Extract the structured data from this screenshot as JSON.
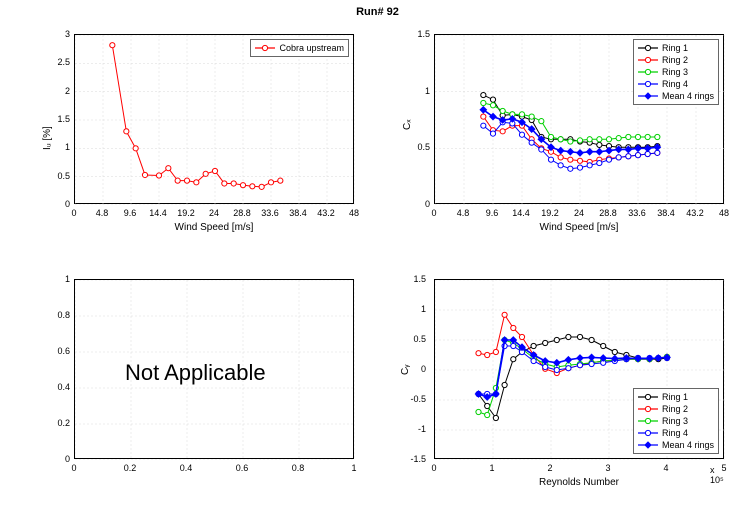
{
  "title": "Run# 92",
  "panels": {
    "tl": {
      "xlabel": "Wind Speed [m/s]",
      "ylabel": "Iᵤ [%]"
    },
    "tr": {
      "xlabel": "Wind Speed [m/s]",
      "ylabel": "Cₓ"
    },
    "bl": {
      "xlabel": "",
      "ylabel": "",
      "text": "Not Applicable"
    },
    "br": {
      "xlabel": "Reynolds Number",
      "ylabel": "Cᵧ",
      "exp": "x 10⁵"
    }
  },
  "legends": {
    "tl": [
      {
        "label": "Cobra upstream",
        "color": "#ff0000",
        "marker": "o"
      }
    ],
    "tr": [
      {
        "label": "Ring 1",
        "color": "#000000",
        "marker": "o"
      },
      {
        "label": "Ring 2",
        "color": "#ff0000",
        "marker": "o"
      },
      {
        "label": "Ring 3",
        "color": "#00d000",
        "marker": "o"
      },
      {
        "label": "Ring 4",
        "color": "#0000ff",
        "marker": "o"
      },
      {
        "label": "Mean 4 rings",
        "color": "#0000ff",
        "marker": "d",
        "fill": true
      }
    ],
    "br": [
      {
        "label": "Ring 1",
        "color": "#000000",
        "marker": "o"
      },
      {
        "label": "Ring 2",
        "color": "#ff0000",
        "marker": "o"
      },
      {
        "label": "Ring 3",
        "color": "#00d000",
        "marker": "o"
      },
      {
        "label": "Ring 4",
        "color": "#0000ff",
        "marker": "o"
      },
      {
        "label": "Mean 4 rings",
        "color": "#0000ff",
        "marker": "d",
        "fill": true
      }
    ]
  },
  "axes": {
    "tl": {
      "xlim": [
        0,
        48
      ],
      "ylim": [
        0,
        3
      ],
      "xticks": [
        0,
        4.8,
        9.6,
        14.4,
        19.2,
        24,
        28.8,
        33.6,
        38.4,
        43.2,
        48
      ],
      "yticks": [
        0,
        0.5,
        1,
        1.5,
        2,
        2.5,
        3
      ]
    },
    "tr": {
      "xlim": [
        0,
        48
      ],
      "ylim": [
        0,
        1.5
      ],
      "xticks": [
        0,
        4.8,
        9.6,
        14.4,
        19.2,
        24,
        28.8,
        33.6,
        38.4,
        43.2,
        48
      ],
      "yticks": [
        0,
        0.5,
        1,
        1.5
      ]
    },
    "bl": {
      "xlim": [
        0,
        1
      ],
      "ylim": [
        0,
        1
      ],
      "xticks": [
        0,
        0.2,
        0.4,
        0.6,
        0.8,
        1
      ],
      "yticks": [
        0,
        0.2,
        0.4,
        0.6,
        0.8,
        1
      ]
    },
    "br": {
      "xlim": [
        0,
        5
      ],
      "ylim": [
        -1.5,
        1.5
      ],
      "xticks": [
        0,
        1,
        2,
        3,
        4,
        5
      ],
      "yticks": [
        -1.5,
        -1,
        -0.5,
        0,
        0.5,
        1,
        1.5
      ]
    }
  },
  "chart_data": [
    {
      "id": "tl",
      "type": "line",
      "title": "",
      "xlabel": "Wind Speed [m/s]",
      "ylabel": "Iu [%]",
      "xlim": [
        0,
        48
      ],
      "ylim": [
        0,
        3
      ],
      "series": [
        {
          "name": "Cobra upstream",
          "color": "#ff0000",
          "marker": "o",
          "x": [
            6.4,
            8.8,
            10.4,
            12.0,
            14.4,
            16.0,
            17.6,
            19.2,
            20.8,
            22.4,
            24.0,
            25.6,
            27.2,
            28.8,
            30.4,
            32.0,
            33.6,
            35.2
          ],
          "y": [
            2.82,
            1.3,
            1.0,
            0.53,
            0.52,
            0.65,
            0.43,
            0.43,
            0.4,
            0.55,
            0.6,
            0.38,
            0.38,
            0.35,
            0.33,
            0.32,
            0.4,
            0.43
          ]
        }
      ]
    },
    {
      "id": "tr",
      "type": "line",
      "title": "",
      "xlabel": "Wind Speed [m/s]",
      "ylabel": "Cx",
      "xlim": [
        0,
        48
      ],
      "ylim": [
        0,
        1.5
      ],
      "x": [
        8.0,
        9.6,
        11.2,
        12.8,
        14.4,
        16.0,
        17.6,
        19.2,
        20.8,
        22.4,
        24.0,
        25.6,
        27.2,
        28.8,
        30.4,
        32.0,
        33.6,
        35.2,
        36.8
      ],
      "series": [
        {
          "name": "Ring 1",
          "color": "#000000",
          "marker": "o",
          "y": [
            0.97,
            0.93,
            0.79,
            0.8,
            0.78,
            0.75,
            0.6,
            0.58,
            0.58,
            0.58,
            0.56,
            0.55,
            0.53,
            0.52,
            0.51,
            0.51,
            0.51,
            0.51,
            0.52
          ]
        },
        {
          "name": "Ring 2",
          "color": "#ff0000",
          "marker": "o",
          "y": [
            0.78,
            0.66,
            0.65,
            0.7,
            0.7,
            0.58,
            0.5,
            0.47,
            0.42,
            0.4,
            0.39,
            0.38,
            0.4,
            0.41,
            0.42,
            0.43,
            0.44,
            0.45,
            0.46
          ]
        },
        {
          "name": "Ring 3",
          "color": "#00d000",
          "marker": "o",
          "y": [
            0.9,
            0.88,
            0.83,
            0.8,
            0.8,
            0.78,
            0.74,
            0.6,
            0.58,
            0.56,
            0.57,
            0.58,
            0.58,
            0.58,
            0.59,
            0.6,
            0.6,
            0.6,
            0.6
          ]
        },
        {
          "name": "Ring 4",
          "color": "#0000ff",
          "marker": "o",
          "y": [
            0.7,
            0.63,
            0.73,
            0.72,
            0.62,
            0.55,
            0.49,
            0.4,
            0.35,
            0.32,
            0.33,
            0.35,
            0.37,
            0.4,
            0.42,
            0.43,
            0.44,
            0.45,
            0.46
          ]
        },
        {
          "name": "Mean 4 rings",
          "color": "#0000ff",
          "marker": "d",
          "fill": true,
          "y": [
            0.84,
            0.78,
            0.75,
            0.76,
            0.73,
            0.67,
            0.58,
            0.51,
            0.48,
            0.47,
            0.46,
            0.47,
            0.47,
            0.48,
            0.49,
            0.49,
            0.5,
            0.5,
            0.51
          ]
        }
      ]
    },
    {
      "id": "bl",
      "type": "line",
      "text": "Not Applicable",
      "xlim": [
        0,
        1
      ],
      "ylim": [
        0,
        1
      ],
      "series": []
    },
    {
      "id": "br",
      "type": "line",
      "xlabel": "Reynolds Number",
      "ylabel": "Cy",
      "xlim": [
        0,
        5
      ],
      "ylim": [
        -1.5,
        1.5
      ],
      "x_scale_note": "x10^5",
      "x": [
        0.75,
        0.9,
        1.05,
        1.2,
        1.35,
        1.5,
        1.7,
        1.9,
        2.1,
        2.3,
        2.5,
        2.7,
        2.9,
        3.1,
        3.3,
        3.5,
        3.7,
        3.85,
        4.0
      ],
      "series": [
        {
          "name": "Ring 1",
          "color": "#000000",
          "marker": "o",
          "y": [
            -0.4,
            -0.6,
            -0.8,
            -0.25,
            0.18,
            0.3,
            0.4,
            0.45,
            0.5,
            0.55,
            0.55,
            0.5,
            0.4,
            0.3,
            0.25,
            0.2,
            0.18,
            0.18,
            0.2
          ]
        },
        {
          "name": "Ring 2",
          "color": "#ff0000",
          "marker": "o",
          "y": [
            0.28,
            0.25,
            0.3,
            0.92,
            0.7,
            0.55,
            0.25,
            0.02,
            -0.05,
            0.03,
            0.08,
            0.12,
            0.15,
            0.16,
            0.18,
            0.18,
            0.18,
            0.2,
            0.22
          ]
        },
        {
          "name": "Ring 3",
          "color": "#00d000",
          "marker": "o",
          "y": [
            -0.7,
            -0.75,
            -0.3,
            0.5,
            0.45,
            0.35,
            0.2,
            0.1,
            0.05,
            0.08,
            0.1,
            0.12,
            0.15,
            0.16,
            0.18,
            0.18,
            0.18,
            0.2,
            0.22
          ]
        },
        {
          "name": "Ring 4",
          "color": "#0000ff",
          "marker": "o",
          "y": [
            -0.4,
            -0.4,
            -0.4,
            0.4,
            0.4,
            0.3,
            0.15,
            0.05,
            0.0,
            0.03,
            0.08,
            0.1,
            0.12,
            0.15,
            0.18,
            0.2,
            0.2,
            0.2,
            0.2
          ]
        },
        {
          "name": "Mean 4 rings",
          "color": "#0000ff",
          "marker": "d",
          "fill": true,
          "y": [
            -0.4,
            -0.45,
            -0.4,
            0.5,
            0.5,
            0.38,
            0.25,
            0.15,
            0.12,
            0.17,
            0.2,
            0.21,
            0.2,
            0.19,
            0.2,
            0.19,
            0.19,
            0.2,
            0.21
          ]
        }
      ]
    }
  ]
}
